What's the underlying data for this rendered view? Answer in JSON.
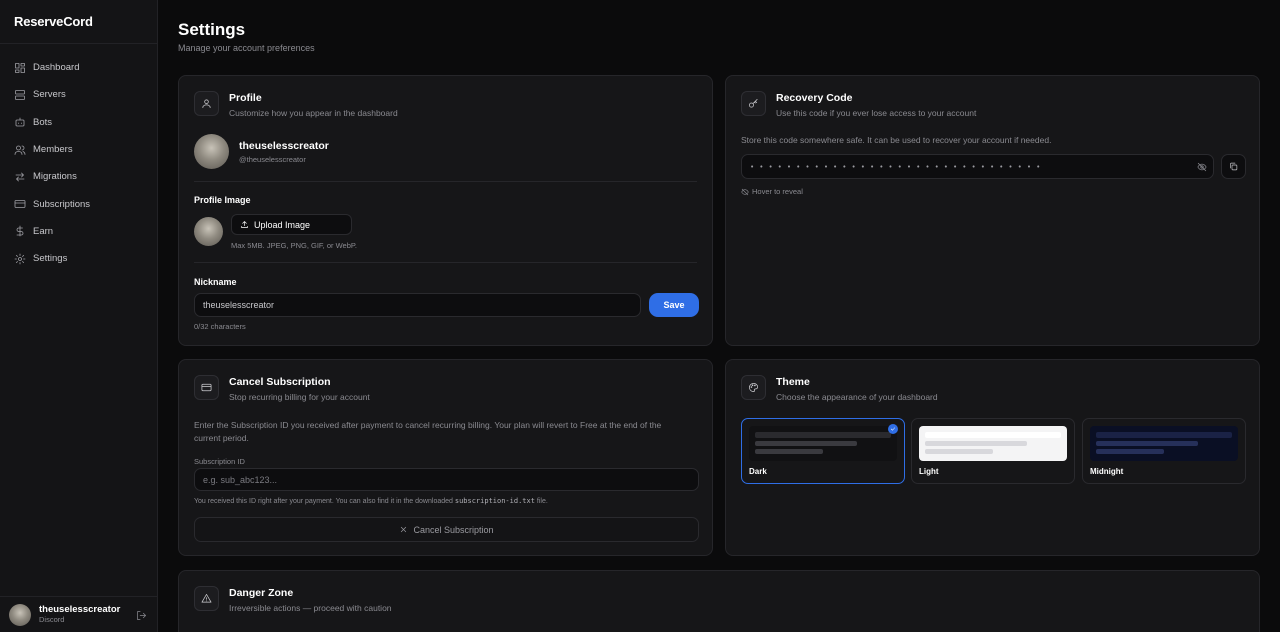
{
  "app": {
    "name": "ReserveCord"
  },
  "sidebar": {
    "items": [
      {
        "label": "Dashboard",
        "icon": "dashboard-icon"
      },
      {
        "label": "Servers",
        "icon": "server-icon"
      },
      {
        "label": "Bots",
        "icon": "bot-icon"
      },
      {
        "label": "Members",
        "icon": "members-icon"
      },
      {
        "label": "Migrations",
        "icon": "migrate-icon"
      },
      {
        "label": "Subscriptions",
        "icon": "card-icon"
      },
      {
        "label": "Earn",
        "icon": "dollar-icon"
      },
      {
        "label": "Settings",
        "icon": "gear-icon"
      }
    ],
    "user": {
      "name": "theuselesscreator",
      "provider": "Discord"
    }
  },
  "page": {
    "title": "Settings",
    "subtitle": "Manage your account preferences"
  },
  "profile": {
    "title": "Profile",
    "description": "Customize how you appear in the dashboard",
    "display_name": "theuselesscreator",
    "handle": "@theuselesscreator",
    "image_label": "Profile Image",
    "upload_label": "Upload Image",
    "upload_hint": "Max 5MB. JPEG, PNG, GIF, or WebP.",
    "nickname_label": "Nickname",
    "nickname_value": "theuselesscreator",
    "save_label": "Save",
    "char_count": "0/32 characters"
  },
  "recovery": {
    "title": "Recovery Code",
    "description": "Use this code if you ever lose access to your account",
    "note": "Store this code somewhere safe. It can be used to recover your account if needed.",
    "masked_code": "• • • • • • • • • • • • • • • • • • • • • • • • • • • • • • • •",
    "hover_hint": "Hover to reveal"
  },
  "cancel_subscription": {
    "title": "Cancel Subscription",
    "description": "Stop recurring billing for your account",
    "body_line1": "Enter the Subscription ID you received after payment to cancel recurring billing. Your plan will revert to Free at the end of the",
    "body_line2": "current period.",
    "field_label": "Subscription ID",
    "placeholder": "e.g. sub_abc123...",
    "hint_prefix": "You received this ID right after your payment. You can also find it in the downloaded",
    "hint_file": "subscription-id.txt",
    "hint_suffix": "file.",
    "button_label": "Cancel Subscription"
  },
  "theme": {
    "title": "Theme",
    "description": "Choose the appearance of your dashboard",
    "options": [
      {
        "name": "Dark",
        "selected": true,
        "colors": {
          "bg": "#111113",
          "l1": "#2a2a2e",
          "l2": "#3a3a3f",
          "l3": "#3a3a3f"
        }
      },
      {
        "name": "Light",
        "selected": false,
        "colors": {
          "bg": "#f4f4f5",
          "l1": "#ffffff",
          "l2": "#d8d8dc",
          "l3": "#d8d8dc"
        }
      },
      {
        "name": "Midnight",
        "selected": false,
        "colors": {
          "bg": "#0a0f24",
          "l1": "#1a2245",
          "l2": "#26305a",
          "l3": "#26305a"
        }
      }
    ]
  },
  "danger": {
    "title": "Danger Zone",
    "description": "Irreversible actions — proceed with caution"
  },
  "colors": {
    "accent": "#2f6ee6",
    "background": "#0b0b0c",
    "card": "#161618"
  }
}
